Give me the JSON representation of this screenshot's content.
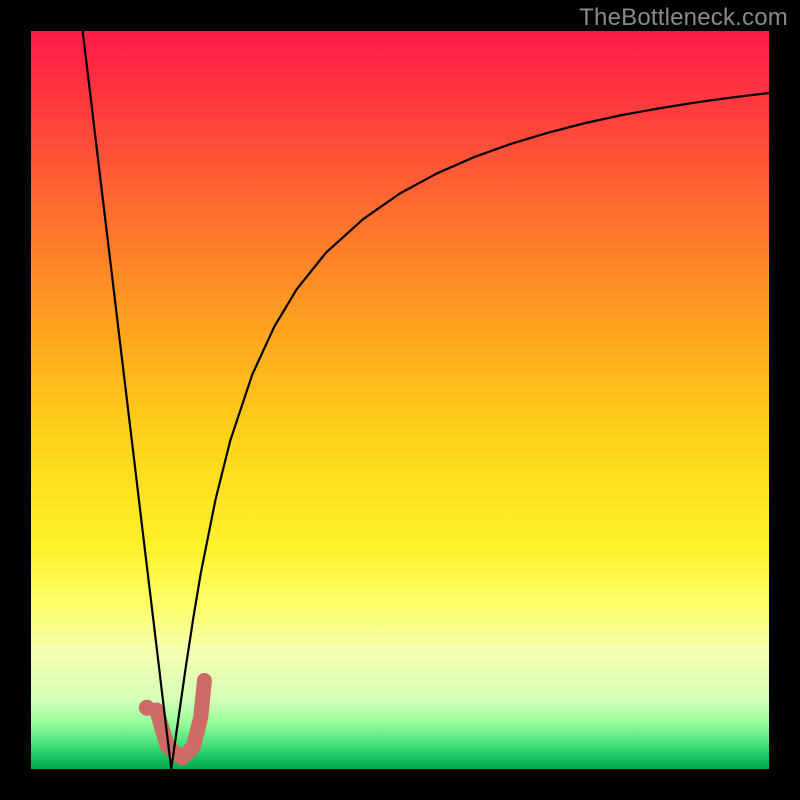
{
  "watermark": {
    "text": "TheBottleneck.com"
  },
  "colors": {
    "frame": "#000000",
    "watermark": "#8a8a8a",
    "curve": "#000000",
    "marker_fill": "#cc6a66",
    "marker_stroke": "#cc6a66",
    "gradient_stops": [
      {
        "offset": 0.0,
        "color": "#ff1a47"
      },
      {
        "offset": 0.1,
        "color": "#ff3a3f"
      },
      {
        "offset": 0.25,
        "color": "#ff6f2e"
      },
      {
        "offset": 0.4,
        "color": "#ffa21f"
      },
      {
        "offset": 0.55,
        "color": "#ffd21a"
      },
      {
        "offset": 0.7,
        "color": "#fff22a"
      },
      {
        "offset": 0.78,
        "color": "#fdff6a"
      },
      {
        "offset": 0.84,
        "color": "#f6ffb0"
      },
      {
        "offset": 0.905,
        "color": "#d6ffb8"
      },
      {
        "offset": 0.935,
        "color": "#9dff9d"
      },
      {
        "offset": 0.965,
        "color": "#49e27a"
      },
      {
        "offset": 0.985,
        "color": "#14c45e"
      },
      {
        "offset": 1.0,
        "color": "#0aa84f"
      }
    ]
  },
  "chart_data": {
    "type": "line",
    "title": "",
    "xlabel": "",
    "ylabel": "",
    "xlim": [
      0,
      100
    ],
    "ylim": [
      0,
      100
    ],
    "series": [
      {
        "name": "left-branch",
        "x": [
          7.0,
          8.0,
          9.0,
          10.0,
          11.0,
          12.0,
          13.0,
          14.0,
          15.0,
          16.0,
          17.0,
          18.0,
          19.0
        ],
        "y": [
          100.0,
          91.7,
          83.3,
          75.0,
          66.7,
          58.3,
          50.0,
          41.7,
          33.3,
          25.0,
          16.7,
          8.3,
          0.0
        ]
      },
      {
        "name": "right-branch",
        "x": [
          19.0,
          20.0,
          21.0,
          22.0,
          23.0,
          25.0,
          27.0,
          30.0,
          33.0,
          36.0,
          40.0,
          45.0,
          50.0,
          55.0,
          60.0,
          65.0,
          70.0,
          75.0,
          80.0,
          85.0,
          90.0,
          95.0,
          100.0
        ],
        "y": [
          0.0,
          7.0,
          14.0,
          20.5,
          26.5,
          36.5,
          44.5,
          53.5,
          60.0,
          65.0,
          70.0,
          74.5,
          78.0,
          80.7,
          82.9,
          84.7,
          86.2,
          87.5,
          88.6,
          89.5,
          90.3,
          91.0,
          91.6
        ]
      }
    ],
    "marker": {
      "name": "J-marker",
      "shape": "hook",
      "points": [
        {
          "x": 17.0,
          "y": 8.0
        },
        {
          "x": 18.5,
          "y": 3.0
        },
        {
          "x": 20.5,
          "y": 1.5
        },
        {
          "x": 22.0,
          "y": 3.0
        },
        {
          "x": 23.0,
          "y": 7.0
        },
        {
          "x": 23.5,
          "y": 12.0
        }
      ],
      "dot": {
        "x": 15.7,
        "y": 8.3
      },
      "stroke_width_px": 15,
      "dot_radius_px": 8
    }
  }
}
